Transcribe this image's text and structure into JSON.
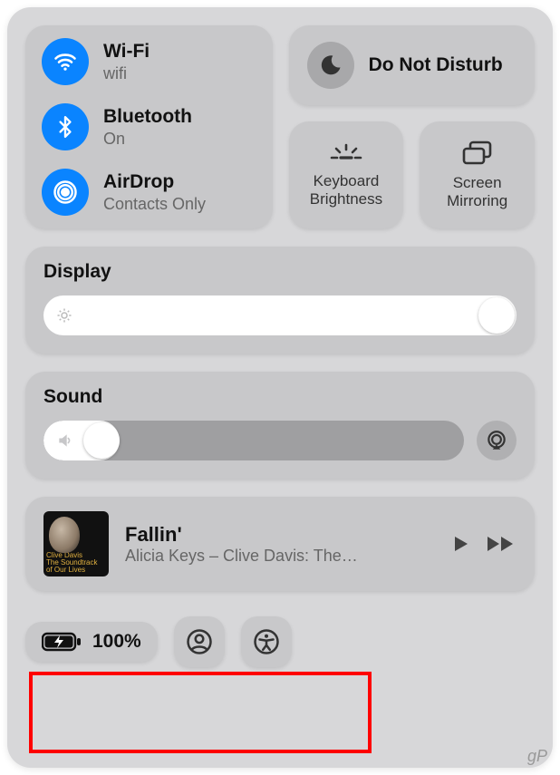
{
  "connectivity": {
    "wifi": {
      "label": "Wi-Fi",
      "status": "wifi",
      "active": true
    },
    "bluetooth": {
      "label": "Bluetooth",
      "status": "On",
      "active": true
    },
    "airdrop": {
      "label": "AirDrop",
      "status": "Contacts Only",
      "active": true
    }
  },
  "dnd": {
    "label": "Do Not Disturb",
    "active": false
  },
  "shortcuts": {
    "keyboard_brightness": {
      "label": "Keyboard Brightness"
    },
    "screen_mirroring": {
      "label": "Screen Mirroring"
    }
  },
  "display": {
    "heading": "Display",
    "level_percent": 100
  },
  "sound": {
    "heading": "Sound",
    "level_percent": 18
  },
  "now_playing": {
    "track": "Fallin'",
    "detail": "Alicia Keys – Clive Davis: The…",
    "album_art_lines": [
      "Clive Davis",
      "The Soundtrack",
      "of Our Lives"
    ]
  },
  "battery": {
    "text": "100%",
    "charging": true
  },
  "watermark": "gP"
}
